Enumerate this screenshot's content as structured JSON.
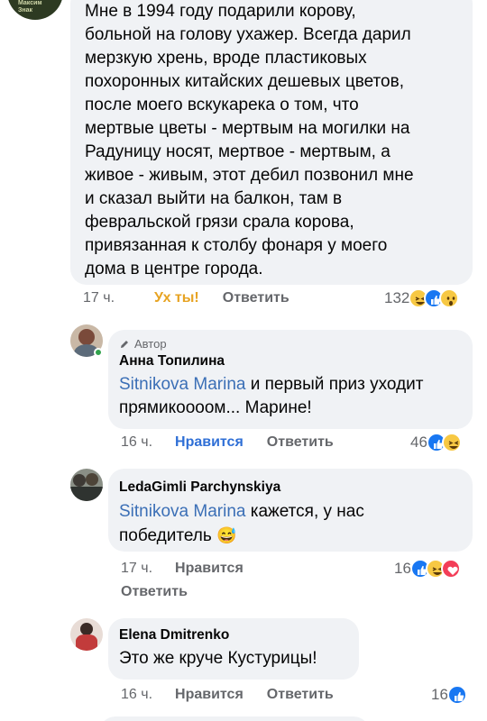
{
  "comments": [
    {
      "text": "Мне в 1994 году подарили корову, больной на голову ухажер. Всегда дарил мерзкую хрень, вроде пластиковых похоронных китайских дешевых цветов, после моего вскукарека о том, что мертвые цветы - мертвым на могилки на Радуницу носят, мертвое - мертвым, а живое - живым, этот дебил позвонил мне и сказал выйти на балкон, там в февральской грязи срала корова, привязанная к столбу фонаря у моего дома в центре города.",
      "lines": [
        "Мне в 1994 году подарили корову,",
        "больной на голову ухажер. Всегда дарил",
        "мерзкую хрень, вроде пластиковых",
        "похоронных китайских дешевых цветов,",
        "после моего вскукарека о том, что",
        "мертвые цветы - мертвым на могилки на",
        "Радуницу носят, мертвое - мертвым, а",
        "живое - живым, этот дебил позвонил мне",
        "и сказал выйти на балкон, там в",
        "февральской грязи срала корова,",
        "привязанная к столбу фонаря у моего",
        "дома в центре города."
      ],
      "time": "17 ч.",
      "reaction_label": "Ух ты!",
      "reply": "Ответить",
      "reactions_count": "132",
      "reactions": [
        "haha-icon",
        "like-icon",
        "wow-icon"
      ]
    },
    {
      "author_tag": "Автор",
      "author": "Анна Топилина",
      "mention": "Sitnikova Marina",
      "text_line1": " и первый приз уходит",
      "text_line2": "прямикоооом... Марине!",
      "time": "16 ч.",
      "like": "Нравится",
      "reply": "Ответить",
      "reactions_count": "46",
      "reactions": [
        "like-icon",
        "haha-icon"
      ]
    },
    {
      "author": "LedaGimli Parchynskiya",
      "mention": "Sitnikova Marina",
      "text_line1": " кажется, у нас",
      "text_line2": "победитель",
      "emoji": "😅",
      "time": "17 ч.",
      "like": "Нравится",
      "reply": "Ответить",
      "reactions_count": "16",
      "reactions": [
        "like-icon",
        "haha-icon",
        "love-icon"
      ]
    },
    {
      "author": "Elena Dmitrenko",
      "text": "Это же круче Кустурицы!",
      "time": "16 ч.",
      "like": "Нравится",
      "reply": "Ответить",
      "reactions_count": "16",
      "reactions": [
        "like-icon"
      ]
    }
  ],
  "colors": {
    "bubble": "#f0f2f5",
    "mention": "#3b6fb6",
    "like_active": "#2f6fd6",
    "wow_label": "#e7a322",
    "secondary": "#65676b"
  }
}
